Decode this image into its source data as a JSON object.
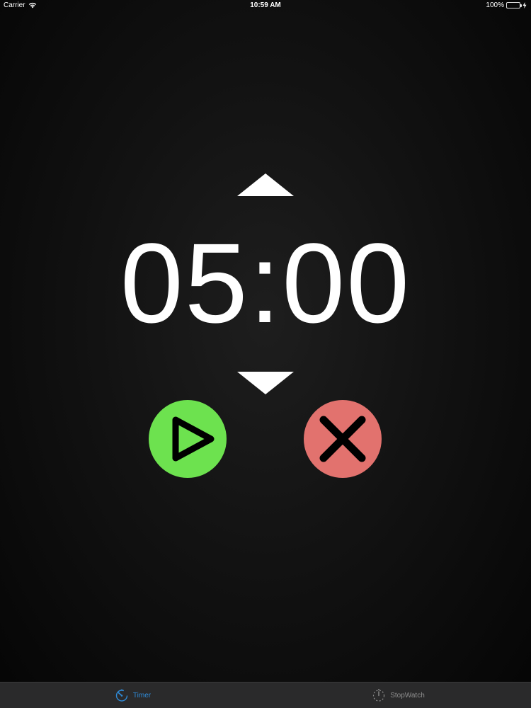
{
  "status_bar": {
    "carrier": "Carrier",
    "time": "10:59 AM",
    "battery_percent": "100%",
    "battery_level": 1.0
  },
  "timer": {
    "display": "05:00"
  },
  "icons": {
    "increase": "triangle-up-icon",
    "decrease": "triangle-down-icon",
    "start": "play-icon",
    "cancel": "close-icon"
  },
  "colors": {
    "play_button": "#6de24f",
    "cancel_button": "#e2726e",
    "tab_active": "#2f8bd8",
    "tab_inactive": "#8e8e8e",
    "battery": "#4cd964"
  },
  "tabs": [
    {
      "label": "Timer",
      "icon": "timer-icon",
      "active": true
    },
    {
      "label": "StopWatch",
      "icon": "stopwatch-icon",
      "active": false
    }
  ]
}
